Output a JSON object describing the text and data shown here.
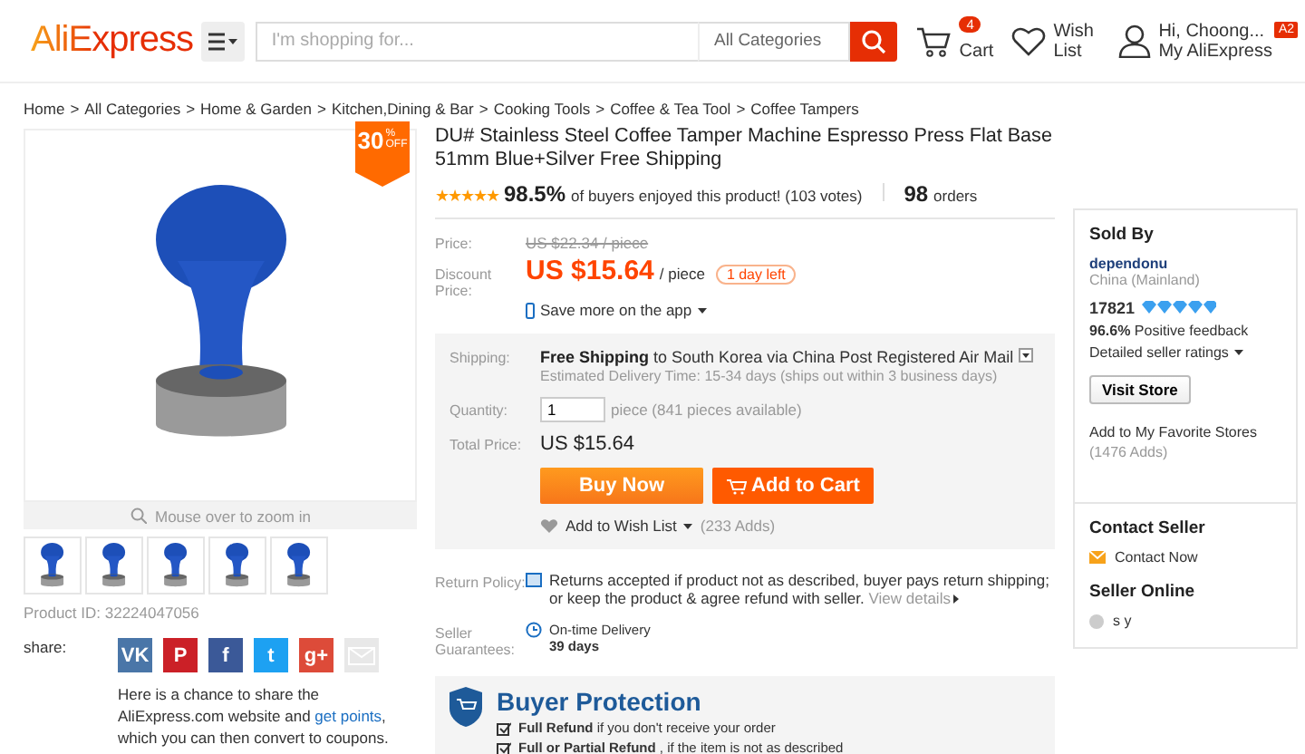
{
  "header": {
    "logo": "AliExpress",
    "search": {
      "placeholder": "I'm shopping for..."
    },
    "category": "All Categories",
    "cart": {
      "count": "4",
      "label": "Cart"
    },
    "wishlist": "Wish List",
    "account": {
      "greeting": "Hi, Choong...",
      "link": "My AliExpress",
      "badge": "A2"
    }
  },
  "breadcrumb": {
    "separator": ">",
    "items": [
      "Home",
      "All Categories",
      "Home & Garden",
      "Kitchen,Dining & Bar",
      "Cooking Tools",
      "Coffee & Tea Tool",
      "Coffee Tampers"
    ]
  },
  "gallery": {
    "discount": {
      "value": "30",
      "unit": "%",
      "suffix": "OFF"
    },
    "zoom_hint": "Mouse over to zoom in",
    "thumbnails": [
      {
        "selected": false
      },
      {
        "selected": false
      },
      {
        "selected": false
      },
      {
        "selected": false
      },
      {
        "selected": false
      }
    ],
    "product_id": "Product ID: 32224047056",
    "share_label": "share:",
    "share_buttons": [
      {
        "label": "VK",
        "color": "#4a76a8"
      },
      {
        "label": "P",
        "color": "#cb2027"
      },
      {
        "label": "f",
        "color": "#3b5998"
      },
      {
        "label": "t",
        "color": "#1da1f2"
      },
      {
        "label": "g+",
        "color": "#dd4b39"
      },
      {
        "color": "#e8e8e8"
      }
    ],
    "share_text": "Here is a chance to share the AliExpress.com website and",
    "share_link": "get points",
    "share_text_end": ", which you can then convert to coupons."
  },
  "product": {
    "title": "DU# Stainless Steel Coffee Tamper Machine Espresso Press Flat Base 51mm Blue+Silver Free Shipping",
    "stars": 5,
    "rating": "98.5%",
    "rating_text": "of buyers enjoyed this product! (103 votes)",
    "orders_count": "98",
    "orders_label": "orders",
    "price_label": "Price:",
    "old_price": "US $22.34 / piece",
    "discount_label": "Discount Price:",
    "price": "US $15.64",
    "price_unit": "/ piece",
    "time_left": "1 day left",
    "app_promo": "Save more on the app",
    "shipping_label": "Shipping:",
    "shipping_free": "Free Shipping",
    "shipping_to": "to South Korea via China Post Registered Air Mail",
    "delivery": "Estimated Delivery Time: 15-34 days (ships out within 3 business days)",
    "quantity_label": "Quantity:",
    "quantity": "1",
    "quantity_note": "piece (841 pieces available)",
    "total_label": "Total Price:",
    "total": "US $15.64",
    "buy_now": "Buy Now",
    "add_to_cart": "Add to Cart",
    "wishlist": "Add to Wish List",
    "wishlist_count": "(233 Adds)",
    "return_label": "Return Policy:",
    "return_text": "Returns accepted if product not as described, buyer pays return shipping; or keep the product & agree refund with seller.",
    "return_link": "View details",
    "guarantee_label": "Seller Guarantees:",
    "guarantee_title": "On-time Delivery",
    "guarantee_days": "39 days",
    "protection_title": "Buyer Protection",
    "protection_items": [
      "**Full Refund** if you don't receive your order",
      "**Full or Partial Refund** , if the item is not as described"
    ]
  },
  "seller": {
    "heading": "Sold By",
    "name": "dependonu",
    "location": "China (Mainland)",
    "score": "17821",
    "feedback_rate": "96.6%",
    "feedback_label": "Positive feedback",
    "ratings_link": "Detailed seller ratings",
    "visit_store": "Visit Store",
    "favorite": "Add to My Favorite Stores",
    "favorite_count": "(1476 Adds)",
    "contact_heading": "Contact Seller",
    "contact_link": "Contact Now",
    "online_heading": "Seller Online",
    "online_name": "s y"
  }
}
